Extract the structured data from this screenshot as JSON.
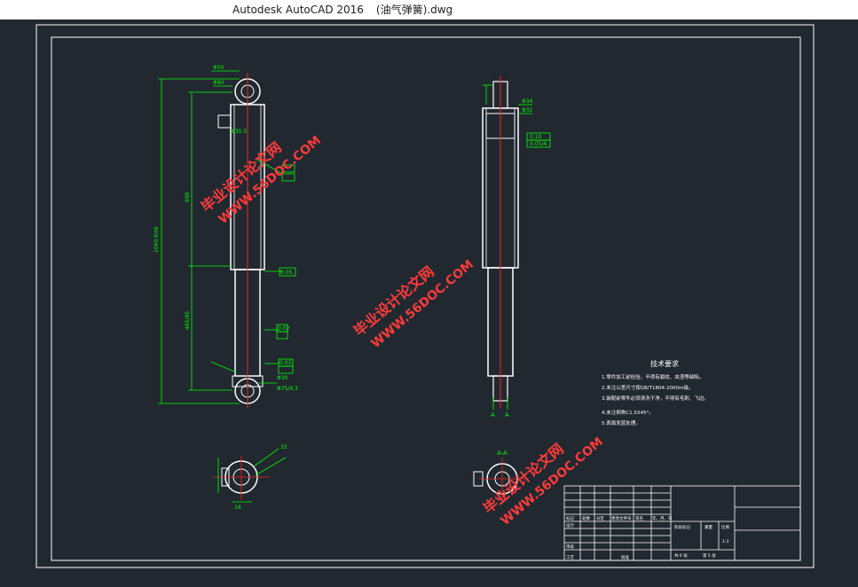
{
  "window": {
    "app_title": "Autodesk AutoCAD 2016",
    "file_name": "(油气弹簧).dwg"
  },
  "colors": {
    "background": "#212830",
    "line": "#ffffff",
    "dimension": "#00ff00",
    "centerline": "#ff2020",
    "title_block": "#ffffff",
    "watermark": "#ff3b3b"
  },
  "watermarks": [
    {
      "line1": "毕业设计论文网",
      "line2": "WWW.56DOC.COM"
    },
    {
      "line1": "毕业设计论文网",
      "line2": "WWW.56DOC.COM"
    },
    {
      "line1": "毕业设计论文网",
      "line2": "WWW.56DOC.COM"
    }
  ],
  "drawing": {
    "dims": {
      "overall_length": "1060.6H8",
      "upper_length": "690",
      "lower_length": "485/45",
      "top_dia": "Φ50",
      "top_dia2": "Φ80",
      "tol1": "0.05",
      "tol2": "0.10",
      "tol3": "0.05/A",
      "tol4": "0.02",
      "tol5": "0.03",
      "end_dia": "Φ75/0.3",
      "eye_dia": "Φ30",
      "small_dim": "18",
      "side_dim": "32",
      "ra": "Φ30.5",
      "right_dim": "Φ34",
      "right_dim2": "Φ32",
      "section_dim": "Φ20"
    },
    "section_label": "A-A",
    "cut_labels": [
      "A",
      "A"
    ],
    "tech_req": {
      "title": "技术要求",
      "items": [
        "1.零件加工前检验，不得有裂纹、夹渣等缺陷。",
        "2.未注公差尺寸按GB/T1804-2000m级。",
        "3.装配前零件必须清洗干净，不得有毛刺、飞边。",
        "4.未注倒角C1.5X45°。",
        "5.表面发蓝处理。"
      ]
    },
    "title_block": {
      "row_labels": [
        "标记",
        "处数",
        "分区",
        "更改文件号",
        "签名",
        "年、月、日"
      ],
      "design": "设计",
      "check": "审核",
      "process": "工艺",
      "approve": "批准",
      "stage_mark": "阶段标记",
      "weight": "重量",
      "scale_label": "比例",
      "scale": "1:3",
      "sheets": "共 6 张",
      "sheet_no": "第 5 张"
    }
  }
}
